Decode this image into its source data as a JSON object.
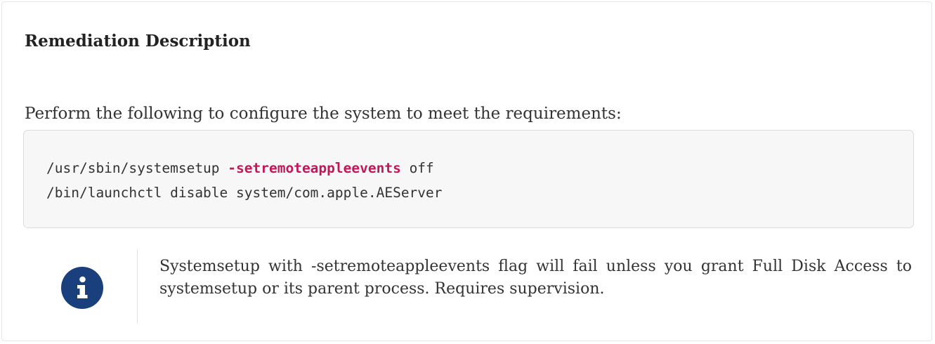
{
  "section": {
    "title": "Remediation Description",
    "intro": "Perform the following to configure the system to meet the requirements:"
  },
  "code": {
    "line1_command": "/usr/sbin/systemsetup ",
    "line1_flag": "-setremoteappleevents",
    "line1_arg": " off",
    "line2": "/bin/launchctl disable system/com.apple.AEServer"
  },
  "note": {
    "icon": "info-circle-icon",
    "text": "Systemsetup with -setremoteappleevents flag will fail unless you grant Full Disk Access to systemsetup or its parent process. Requires supervision."
  },
  "colors": {
    "flag": "#c2185b",
    "icon": "#19407c",
    "code_background": "#f7f7f8"
  }
}
